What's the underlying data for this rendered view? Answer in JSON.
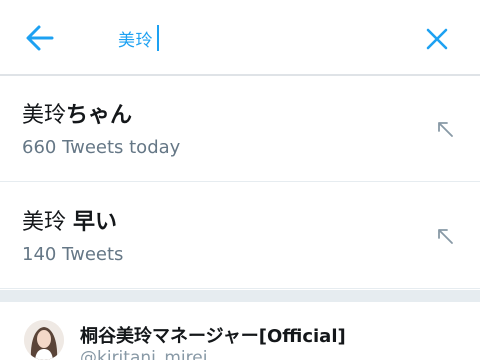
{
  "search": {
    "query": "美玲",
    "back_icon": "back-arrow-icon",
    "clear_icon": "close-icon",
    "accent_color": "#1da1f2"
  },
  "suggestions": [
    {
      "prefix": "美玲",
      "highlight": "ちゃん",
      "subtitle": "660 Tweets today",
      "icon": "arrow-up-left-icon"
    },
    {
      "prefix": "美玲 ",
      "highlight": "早い",
      "subtitle": "140 Tweets",
      "icon": "arrow-up-left-icon"
    }
  ],
  "account": {
    "name": "桐谷美玲マネージャー[Official]",
    "handle": "@kiritani_mirei"
  }
}
